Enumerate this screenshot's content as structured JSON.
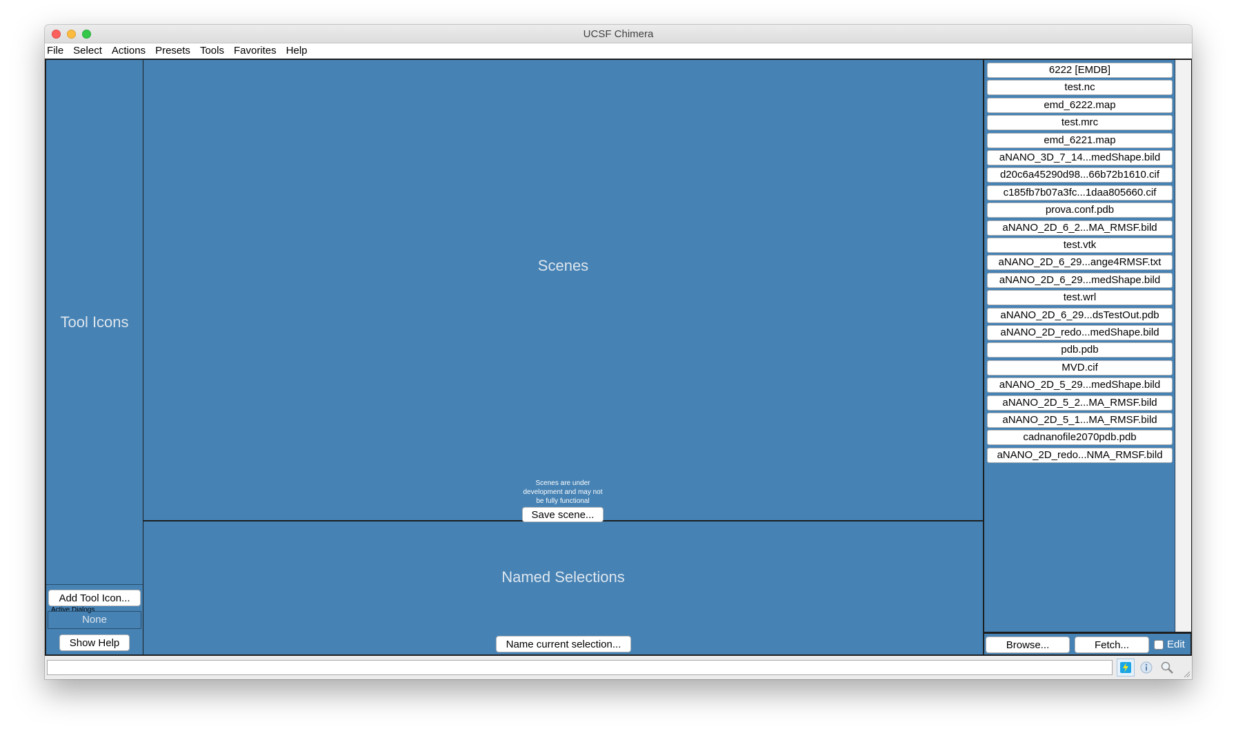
{
  "window": {
    "title": "UCSF Chimera"
  },
  "menubar": {
    "items": [
      "File",
      "Select",
      "Actions",
      "Presets",
      "Tools",
      "Favorites",
      "Help"
    ]
  },
  "left": {
    "tool_icons_label": "Tool Icons",
    "add_tool_icon_label": "Add Tool Icon...",
    "active_dialogs_label": "Active Dialogs",
    "active_dialogs_value": "None",
    "show_help_label": "Show Help"
  },
  "scenes": {
    "label": "Scenes",
    "note": "Scenes are under\ndevelopment and may not\nbe fully functional",
    "save_label": "Save scene..."
  },
  "named": {
    "label": "Named Selections",
    "name_current_label": "Name current selection..."
  },
  "files": {
    "items": [
      "6222 [EMDB]",
      "test.nc",
      "emd_6222.map",
      "test.mrc",
      "emd_6221.map",
      "aNANO_3D_7_14...medShape.bild",
      "d20c6a45290d98...66b72b1610.cif",
      "c185fb7b07a3fc...1daa805660.cif",
      "prova.conf.pdb",
      "aNANO_2D_6_2...MA_RMSF.bild",
      "test.vtk",
      "aNANO_2D_6_29...ange4RMSF.txt",
      "aNANO_2D_6_29...medShape.bild",
      "test.wrl",
      "aNANO_2D_6_29...dsTestOut.pdb",
      "aNANO_2D_redo...medShape.bild",
      "pdb.pdb",
      "MVD.cif",
      "aNANO_2D_5_29...medShape.bild",
      "aNANO_2D_5_2...MA_RMSF.bild",
      "aNANO_2D_5_1...MA_RMSF.bild",
      "cadnanofile2070pdb.pdb",
      "aNANO_2D_redo...NMA_RMSF.bild"
    ],
    "browse_label": "Browse...",
    "fetch_label": "Fetch...",
    "edit_label": "Edit"
  },
  "status": {
    "command_value": "",
    "icons": [
      "lightning-icon",
      "info-icon",
      "magnifier-icon"
    ]
  }
}
